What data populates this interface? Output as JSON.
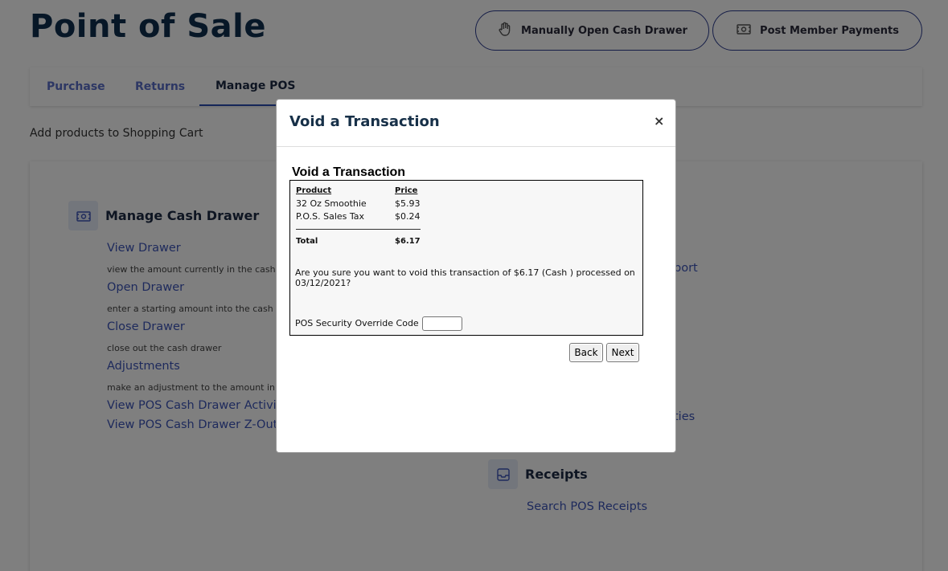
{
  "header": {
    "title": "Point of Sale",
    "open_drawer_label": "Manually Open Cash Drawer",
    "post_payments_label": "Post Member Payments"
  },
  "tabs": [
    {
      "label": "Purchase",
      "active": false
    },
    {
      "label": "Returns",
      "active": false
    },
    {
      "label": "Manage POS",
      "active": true
    }
  ],
  "subtitle": "Add products to Shopping Cart",
  "cash_drawer": {
    "heading": "Manage Cash Drawer",
    "items": [
      {
        "label": "View Drawer",
        "desc": "view the amount currently in the cash"
      },
      {
        "label": "Open Drawer",
        "desc": "enter a starting amount into the cash"
      },
      {
        "label": "Close Drawer",
        "desc": "close out the cash drawer"
      },
      {
        "label": "Adjustments",
        "desc": "make an adjustment to the amount in"
      },
      {
        "label": "View POS Cash Drawer Activit"
      },
      {
        "label": "View POS Cash Drawer Z-Out"
      }
    ]
  },
  "right_column": {
    "link_partial_1": "port",
    "link_partial_2": "ties"
  },
  "receipts": {
    "heading": "Receipts",
    "search_label": "Search POS Receipts"
  },
  "modal": {
    "title": "Void a Transaction",
    "close": "×",
    "inner_title": "Void a Transaction",
    "table": {
      "headers": [
        "Product",
        "Price"
      ],
      "rows": [
        {
          "product": "32 Oz Smoothie",
          "price": "$5.93"
        },
        {
          "product": "P.O.S. Sales Tax",
          "price": "$0.24"
        }
      ],
      "total_label": "Total",
      "total_value": "$6.17"
    },
    "confirm_text": "Are you sure you want to void this transaction of $6.17 (Cash ) processed on 03/12/2021?",
    "override_label": "POS Security Override Code",
    "override_value": "",
    "back_label": "Back",
    "next_label": "Next"
  }
}
